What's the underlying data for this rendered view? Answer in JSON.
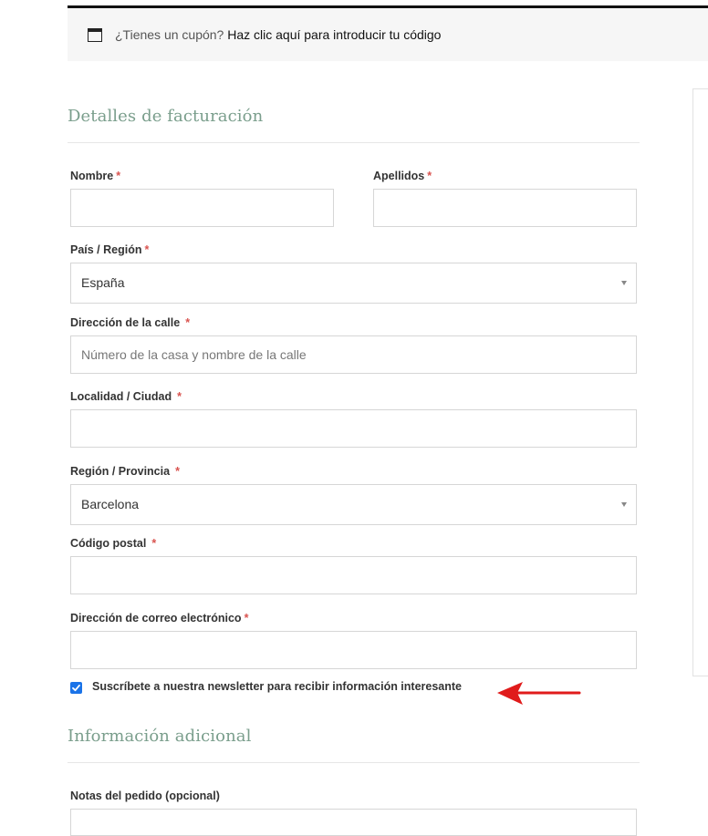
{
  "coupon": {
    "prompt": "¿Tienes un cupón?",
    "link": "Haz clic aquí para introducir tu código"
  },
  "billing": {
    "title": "Detalles de facturación",
    "required_mark": "*",
    "first_name": {
      "label": "Nombre",
      "value": ""
    },
    "last_name": {
      "label": "Apellidos",
      "value": ""
    },
    "country": {
      "label": "País / Región",
      "selected": "España"
    },
    "street": {
      "label": "Dirección de la calle",
      "placeholder": "Número de la casa y nombre de la calle",
      "value": ""
    },
    "city": {
      "label": "Localidad / Ciudad",
      "value": ""
    },
    "state": {
      "label": "Región / Provincia",
      "selected": "Barcelona"
    },
    "postcode": {
      "label": "Código postal",
      "value": ""
    },
    "email": {
      "label": "Dirección de correo electrónico",
      "value": ""
    },
    "newsletter": {
      "label": "Suscríbete a nuestra newsletter para recibir información interesante",
      "checked": true
    }
  },
  "additional": {
    "title": "Información adicional",
    "notes_label": "Notas del pedido (opcional)"
  },
  "colors": {
    "accent_title": "#7a9e8c",
    "required": "#d9534f",
    "checkbox": "#1a73e8",
    "arrow": "#e01b1b"
  },
  "icons": {
    "coupon": "window-icon",
    "select": "chevron-down-icon",
    "annotation": "red-arrow-icon"
  }
}
